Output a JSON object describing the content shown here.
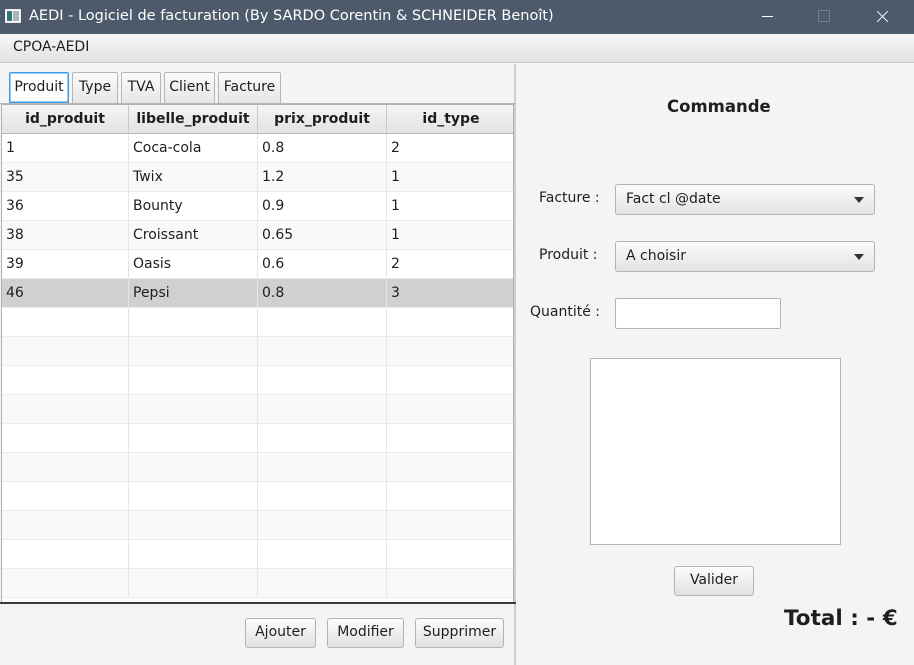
{
  "window": {
    "title": "AEDI - Logiciel de facturation (By SARDO Corentin & SCHNEIDER Benoît)"
  },
  "menu": {
    "items": [
      "CPOA-AEDI"
    ]
  },
  "tabs": [
    {
      "label": "Produit",
      "active": true
    },
    {
      "label": "Type",
      "active": false
    },
    {
      "label": "TVA",
      "active": false
    },
    {
      "label": "Client",
      "active": false
    },
    {
      "label": "Facture",
      "active": false
    }
  ],
  "table": {
    "columns": [
      "id_produit",
      "libelle_produit",
      "prix_produit",
      "id_type"
    ],
    "rows": [
      [
        "1",
        "Coca-cola",
        "0.8",
        "2"
      ],
      [
        "35",
        "Twix",
        "1.2",
        "1"
      ],
      [
        "36",
        "Bounty",
        "0.9",
        "1"
      ],
      [
        "38",
        "Croissant",
        "0.65",
        "1"
      ],
      [
        "39",
        "Oasis",
        "0.6",
        "2"
      ],
      [
        "46",
        "Pepsi",
        "0.8",
        "3"
      ]
    ],
    "selected_row": 5
  },
  "actions": {
    "add_label": "Ajouter",
    "edit_label": "Modifier",
    "delete_label": "Supprimer"
  },
  "commande": {
    "title": "Commande",
    "facture_label": "Facture :",
    "facture_value": "Fact cl @date",
    "produit_label": "Produit :",
    "produit_value": "A choisir",
    "quantite_label": "Quantité :",
    "quantite_value": "",
    "valider_label": "Valider",
    "total_text": "Total : - €"
  },
  "colors": {
    "titlebar": "#4d5a6b",
    "selected_row": "#d0d0d0",
    "active_tab_border": "#3e9be3"
  }
}
